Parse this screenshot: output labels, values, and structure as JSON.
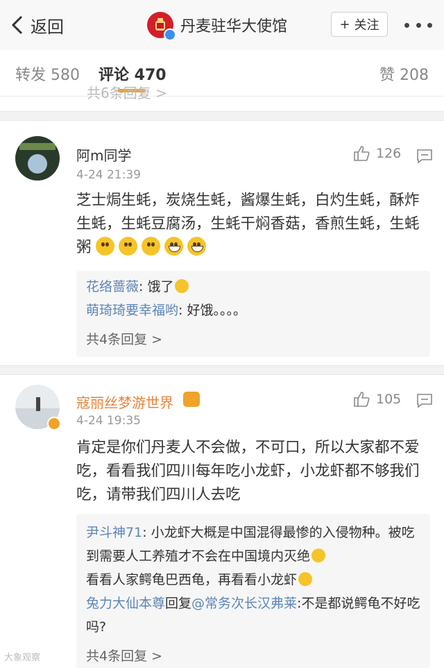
{
  "header": {
    "back_label": "返回",
    "title": "丹麦驻华大使馆",
    "follow_label": "关注"
  },
  "tabs": {
    "repost": "转发 580",
    "comments": "评论 470",
    "likes": "赞 208"
  },
  "cut_text": "共6条回复 >",
  "comments": [
    {
      "name": "阿m同学",
      "time": "4-24 21:39",
      "likes": "126",
      "text": "芝士焗生蚝，炭烧生蚝，酱爆生蚝，白灼生蚝，酥炸生蚝，生蚝豆腐汤，生蚝干焖香菇，香煎生蚝，生蚝粥",
      "replies": [
        {
          "user": "花络蔷薇",
          "text": ": 饿了"
        },
        {
          "user": "萌琦琦要幸福哟",
          "text": ": 好饿。。。。"
        }
      ],
      "more": "共4条回复 >"
    },
    {
      "name": "寇丽丝梦游世界",
      "time": "4-24 19:35",
      "likes": "105",
      "text": "肯定是你们丹麦人不会做，不可口，所以大家都不爱吃，看看我们四川每年吃小龙虾，小龙虾都不够我们吃，请带我们四川人去吃",
      "replies": [
        {
          "user": "尹斗神71",
          "text": ": 小龙虾大概是中国混得最惨的入侵物种。被吃到需要人工养殖才不会在中国境内灭绝"
        },
        {
          "user": "",
          "text": "看看人家鳄龟巴西龟，再看看小龙虾"
        },
        {
          "user": "兔力大仙本尊",
          "text": "回复",
          "mention": "@常务次长汉弗莱",
          "tail": ":不是都说鳄龟不好吃吗?"
        }
      ],
      "more": "共4条回复 >"
    }
  ],
  "watermark": "大象观察"
}
